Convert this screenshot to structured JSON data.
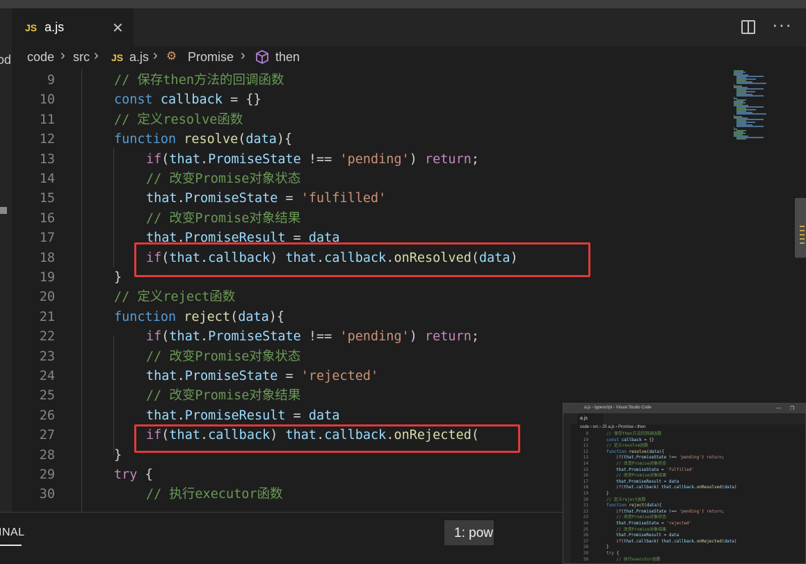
{
  "window": {
    "title": "a.js - typescript - Visual Studio Code"
  },
  "left_edge": {
    "text": "od"
  },
  "tab": {
    "icon": "JS",
    "name": "a.js",
    "close": "✕",
    "active_file": true
  },
  "tab_actions": {
    "split_editor": "split-editor-icon",
    "more": "···"
  },
  "breadcrumb": {
    "items": [
      "code",
      "src",
      "a.js",
      "Promise",
      "then"
    ],
    "file_icon": "JS",
    "separator": "›"
  },
  "code_lines": [
    {
      "n": "9",
      "indent": 1,
      "tokens": [
        [
          "cm",
          "// 保存then方法的回调函数"
        ]
      ]
    },
    {
      "n": "10",
      "indent": 1,
      "tokens": [
        [
          "k",
          "const "
        ],
        [
          "v",
          "callback "
        ],
        [
          "w",
          "= {}"
        ]
      ]
    },
    {
      "n": "11",
      "indent": 1,
      "tokens": [
        [
          "cm",
          "// 定义resolve函数"
        ]
      ]
    },
    {
      "n": "12",
      "indent": 1,
      "tokens": [
        [
          "k",
          "function "
        ],
        [
          "f",
          "resolve"
        ],
        [
          "w",
          "("
        ],
        [
          "v",
          "data"
        ],
        [
          "w",
          "){"
        ]
      ]
    },
    {
      "n": "13",
      "indent": 2,
      "tokens": [
        [
          "c",
          "if"
        ],
        [
          "w",
          "("
        ],
        [
          "v",
          "that"
        ],
        [
          "w",
          "."
        ],
        [
          "v",
          "PromiseState "
        ],
        [
          "w",
          "!== "
        ],
        [
          "s",
          "'pending'"
        ],
        [
          "w",
          ") "
        ],
        [
          "c",
          "return"
        ],
        [
          "w",
          ";"
        ]
      ]
    },
    {
      "n": "14",
      "indent": 2,
      "tokens": [
        [
          "cm",
          "// 改变Promise对象状态"
        ]
      ]
    },
    {
      "n": "15",
      "indent": 2,
      "tokens": [
        [
          "v",
          "that"
        ],
        [
          "w",
          "."
        ],
        [
          "v",
          "PromiseState "
        ],
        [
          "w",
          "= "
        ],
        [
          "s",
          "'fulfilled'"
        ]
      ]
    },
    {
      "n": "16",
      "indent": 2,
      "tokens": [
        [
          "cm",
          "// 改变Promise对象结果"
        ]
      ]
    },
    {
      "n": "17",
      "indent": 2,
      "tokens": [
        [
          "v",
          "that"
        ],
        [
          "w",
          "."
        ],
        [
          "v",
          "PromiseResult "
        ],
        [
          "w",
          "= "
        ],
        [
          "v",
          "data"
        ]
      ]
    },
    {
      "n": "18",
      "indent": 2,
      "tokens": [
        [
          "c",
          "if"
        ],
        [
          "w",
          "("
        ],
        [
          "v",
          "that"
        ],
        [
          "w",
          "."
        ],
        [
          "v",
          "callback"
        ],
        [
          "w",
          ") "
        ],
        [
          "v",
          "that"
        ],
        [
          "w",
          "."
        ],
        [
          "v",
          "callback"
        ],
        [
          "w",
          "."
        ],
        [
          "f",
          "onResolved"
        ],
        [
          "w",
          "("
        ],
        [
          "v",
          "data"
        ],
        [
          "w",
          ")"
        ]
      ]
    },
    {
      "n": "19",
      "indent": 1,
      "tokens": [
        [
          "w",
          "}"
        ]
      ]
    },
    {
      "n": "20",
      "indent": 1,
      "tokens": [
        [
          "cm",
          "// 定义reject函数"
        ]
      ]
    },
    {
      "n": "21",
      "indent": 1,
      "tokens": [
        [
          "k",
          "function "
        ],
        [
          "f",
          "reject"
        ],
        [
          "w",
          "("
        ],
        [
          "v",
          "data"
        ],
        [
          "w",
          "){"
        ]
      ]
    },
    {
      "n": "22",
      "indent": 2,
      "tokens": [
        [
          "c",
          "if"
        ],
        [
          "w",
          "("
        ],
        [
          "v",
          "that"
        ],
        [
          "w",
          "."
        ],
        [
          "v",
          "PromiseState "
        ],
        [
          "w",
          "!== "
        ],
        [
          "s",
          "'pending'"
        ],
        [
          "w",
          ") "
        ],
        [
          "c",
          "return"
        ],
        [
          "w",
          ";"
        ]
      ]
    },
    {
      "n": "23",
      "indent": 2,
      "tokens": [
        [
          "cm",
          "// 改变Promise对象状态"
        ]
      ]
    },
    {
      "n": "24",
      "indent": 2,
      "tokens": [
        [
          "v",
          "that"
        ],
        [
          "w",
          "."
        ],
        [
          "v",
          "PromiseState "
        ],
        [
          "w",
          "= "
        ],
        [
          "s",
          "'rejected'"
        ]
      ]
    },
    {
      "n": "25",
      "indent": 2,
      "tokens": [
        [
          "cm",
          "// 改变Promise对象结果"
        ]
      ]
    },
    {
      "n": "26",
      "indent": 2,
      "tokens": [
        [
          "v",
          "that"
        ],
        [
          "w",
          "."
        ],
        [
          "v",
          "PromiseResult "
        ],
        [
          "w",
          "= "
        ],
        [
          "v",
          "data"
        ]
      ]
    },
    {
      "n": "27",
      "indent": 2,
      "tokens": [
        [
          "c",
          "if"
        ],
        [
          "w",
          "("
        ],
        [
          "v",
          "that"
        ],
        [
          "w",
          "."
        ],
        [
          "v",
          "callback"
        ],
        [
          "w",
          ") "
        ],
        [
          "v",
          "that"
        ],
        [
          "w",
          "."
        ],
        [
          "v",
          "callback"
        ],
        [
          "w",
          "."
        ],
        [
          "f",
          "onRejected"
        ],
        [
          "w",
          "("
        ]
      ]
    },
    {
      "n": "28",
      "indent": 1,
      "tokens": [
        [
          "w",
          "}"
        ]
      ]
    },
    {
      "n": "29",
      "indent": 1,
      "tokens": [
        [
          "c",
          "try "
        ],
        [
          "w",
          "{"
        ]
      ]
    },
    {
      "n": "30",
      "indent": 2,
      "tokens": [
        [
          "cm",
          "// 执行executor函数"
        ]
      ]
    }
  ],
  "panel": {
    "tab": "INAL",
    "terminal_label": "1: pow"
  },
  "thumbnail": {
    "title": "a.js - typescript - Visual Studio Code",
    "tab": "a.js",
    "breadcrumb": "code › src › JS a.js › Promise › then",
    "left_text": "bod",
    "lines": [
      {
        "n": "9",
        "indent": 1,
        "tokens": [
          [
            "cm",
            "// 保存then方法的回调函数"
          ]
        ]
      },
      {
        "n": "10",
        "indent": 1,
        "tokens": [
          [
            "k",
            "const "
          ],
          [
            "v",
            "callback "
          ],
          [
            "w",
            "= {}"
          ]
        ]
      },
      {
        "n": "11",
        "indent": 1,
        "tokens": [
          [
            "cm",
            "// 定义resolve函数"
          ]
        ]
      },
      {
        "n": "12",
        "indent": 1,
        "tokens": [
          [
            "k",
            "function "
          ],
          [
            "f",
            "resolve"
          ],
          [
            "w",
            "("
          ],
          [
            "v",
            "data"
          ],
          [
            "w",
            "){"
          ]
        ]
      },
      {
        "n": "13",
        "indent": 2,
        "tokens": [
          [
            "c",
            "if"
          ],
          [
            "w",
            "("
          ],
          [
            "v",
            "that"
          ],
          [
            "w",
            "."
          ],
          [
            "v",
            "PromiseState "
          ],
          [
            "w",
            "!== "
          ],
          [
            "s",
            "'pending'"
          ],
          [
            "w",
            ") "
          ],
          [
            "c",
            "return"
          ],
          [
            "w",
            ";"
          ]
        ]
      },
      {
        "n": "14",
        "indent": 2,
        "tokens": [
          [
            "cm",
            "// 改变Promise对象状态"
          ]
        ]
      },
      {
        "n": "15",
        "indent": 2,
        "tokens": [
          [
            "v",
            "that"
          ],
          [
            "w",
            "."
          ],
          [
            "v",
            "PromiseState "
          ],
          [
            "w",
            "= "
          ],
          [
            "s",
            "'fulfilled'"
          ]
        ]
      },
      {
        "n": "16",
        "indent": 2,
        "tokens": [
          [
            "cm",
            "// 改变Promise对象结果"
          ]
        ]
      },
      {
        "n": "17",
        "indent": 2,
        "tokens": [
          [
            "v",
            "that"
          ],
          [
            "w",
            "."
          ],
          [
            "v",
            "PromiseResult "
          ],
          [
            "w",
            "= "
          ],
          [
            "v",
            "data"
          ]
        ]
      },
      {
        "n": "18",
        "indent": 2,
        "tokens": [
          [
            "c",
            "if"
          ],
          [
            "w",
            "("
          ],
          [
            "v",
            "that"
          ],
          [
            "w",
            "."
          ],
          [
            "v",
            "callback"
          ],
          [
            "w",
            ") "
          ],
          [
            "v",
            "that"
          ],
          [
            "w",
            "."
          ],
          [
            "v",
            "callback"
          ],
          [
            "w",
            "."
          ],
          [
            "f",
            "onResolved"
          ],
          [
            "w",
            "("
          ],
          [
            "v",
            "data"
          ],
          [
            "w",
            ")"
          ]
        ]
      },
      {
        "n": "19",
        "indent": 1,
        "tokens": [
          [
            "w",
            "}"
          ]
        ]
      },
      {
        "n": "20",
        "indent": 1,
        "tokens": [
          [
            "cm",
            "// 定义reject函数"
          ]
        ]
      },
      {
        "n": "21",
        "indent": 1,
        "tokens": [
          [
            "k",
            "function "
          ],
          [
            "f",
            "reject"
          ],
          [
            "w",
            "("
          ],
          [
            "v",
            "data"
          ],
          [
            "w",
            "){"
          ]
        ]
      },
      {
        "n": "22",
        "indent": 2,
        "tokens": [
          [
            "c",
            "if"
          ],
          [
            "w",
            "("
          ],
          [
            "v",
            "that"
          ],
          [
            "w",
            "."
          ],
          [
            "v",
            "PromiseState "
          ],
          [
            "w",
            "!== "
          ],
          [
            "s",
            "'pending'"
          ],
          [
            "w",
            ") "
          ],
          [
            "c",
            "return"
          ],
          [
            "w",
            ";"
          ]
        ]
      },
      {
        "n": "23",
        "indent": 2,
        "tokens": [
          [
            "cm",
            "// 改变Promise对象状态"
          ]
        ]
      },
      {
        "n": "24",
        "indent": 2,
        "tokens": [
          [
            "v",
            "that"
          ],
          [
            "w",
            "."
          ],
          [
            "v",
            "PromiseState "
          ],
          [
            "w",
            "= "
          ],
          [
            "s",
            "'rejected'"
          ]
        ]
      },
      {
        "n": "25",
        "indent": 2,
        "tokens": [
          [
            "cm",
            "// 改变Promise对象结果"
          ]
        ]
      },
      {
        "n": "26",
        "indent": 2,
        "tokens": [
          [
            "v",
            "that"
          ],
          [
            "w",
            "."
          ],
          [
            "v",
            "PromiseResult "
          ],
          [
            "w",
            "= "
          ],
          [
            "v",
            "data"
          ]
        ]
      },
      {
        "n": "27",
        "indent": 2,
        "tokens": [
          [
            "c",
            "if"
          ],
          [
            "w",
            "("
          ],
          [
            "v",
            "that"
          ],
          [
            "w",
            "."
          ],
          [
            "v",
            "callback"
          ],
          [
            "w",
            ") "
          ],
          [
            "v",
            "that"
          ],
          [
            "w",
            "."
          ],
          [
            "v",
            "callback"
          ],
          [
            "w",
            "."
          ],
          [
            "f",
            "onRejected"
          ],
          [
            "w",
            "("
          ],
          [
            "v",
            "data"
          ],
          [
            "w",
            ")"
          ]
        ]
      },
      {
        "n": "28",
        "indent": 1,
        "tokens": [
          [
            "w",
            "}"
          ]
        ]
      },
      {
        "n": "29",
        "indent": 1,
        "tokens": [
          [
            "c",
            "try "
          ],
          [
            "w",
            "{"
          ]
        ]
      },
      {
        "n": "30",
        "indent": 2,
        "tokens": [
          [
            "cm",
            "// 执行executor函数"
          ]
        ]
      }
    ]
  },
  "colors": {
    "keyword": "#569cd6",
    "control": "#c586c0",
    "function": "#dcdcaa",
    "variable": "#9cdcfe",
    "string": "#ce9178",
    "comment": "#6a9955",
    "highlight_box": "#e03a3a"
  }
}
